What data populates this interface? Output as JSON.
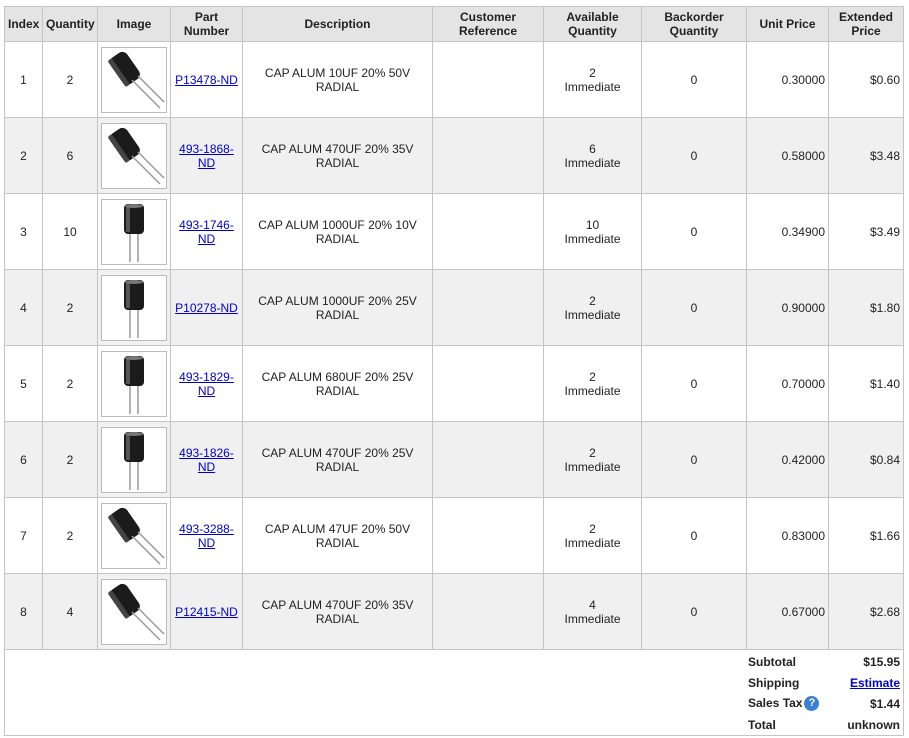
{
  "headers": {
    "index": "Index",
    "quantity": "Quantity",
    "image": "Image",
    "part_number_1": "Part",
    "part_number_2": "Number",
    "description": "Description",
    "customer_reference_1": "Customer",
    "customer_reference_2": "Reference",
    "available_1": "Available",
    "available_2": "Quantity",
    "backorder_1": "Backorder",
    "backorder_2": "Quantity",
    "unit_price": "Unit Price",
    "extended_1": "Extended",
    "extended_2": "Price"
  },
  "rows": [
    {
      "index": "1",
      "qty": "2",
      "pn1": "P13478-ND",
      "pn2": "",
      "desc1": "CAP ALUM 10UF 20% 50V",
      "desc2": "RADIAL",
      "avail_qty": "2",
      "avail_status": "Immediate",
      "backorder": "0",
      "unit": "0.30000",
      "ext": "$0.60",
      "thumb": "cap-bent"
    },
    {
      "index": "2",
      "qty": "6",
      "pn1": "493-1868-",
      "pn2": "ND",
      "desc1": "CAP ALUM 470UF 20% 35V",
      "desc2": "RADIAL",
      "avail_qty": "6",
      "avail_status": "Immediate",
      "backorder": "0",
      "unit": "0.58000",
      "ext": "$3.48",
      "thumb": "cap-bent"
    },
    {
      "index": "3",
      "qty": "10",
      "pn1": "493-1746-",
      "pn2": "ND",
      "desc1": "CAP ALUM 1000UF 20% 10V",
      "desc2": "RADIAL",
      "avail_qty": "10",
      "avail_status": "Immediate",
      "backorder": "0",
      "unit": "0.34900",
      "ext": "$3.49",
      "thumb": "cap-upright"
    },
    {
      "index": "4",
      "qty": "2",
      "pn1": "P10278-ND",
      "pn2": "",
      "desc1": "CAP ALUM 1000UF 20% 25V",
      "desc2": "RADIAL",
      "avail_qty": "2",
      "avail_status": "Immediate",
      "backorder": "0",
      "unit": "0.90000",
      "ext": "$1.80",
      "thumb": "cap-upright"
    },
    {
      "index": "5",
      "qty": "2",
      "pn1": "493-1829-",
      "pn2": "ND",
      "desc1": "CAP ALUM 680UF 20% 25V",
      "desc2": "RADIAL",
      "avail_qty": "2",
      "avail_status": "Immediate",
      "backorder": "0",
      "unit": "0.70000",
      "ext": "$1.40",
      "thumb": "cap-upright"
    },
    {
      "index": "6",
      "qty": "2",
      "pn1": "493-1826-",
      "pn2": "ND",
      "desc1": "CAP ALUM 470UF 20% 25V",
      "desc2": "RADIAL",
      "avail_qty": "2",
      "avail_status": "Immediate",
      "backorder": "0",
      "unit": "0.42000",
      "ext": "$0.84",
      "thumb": "cap-upright"
    },
    {
      "index": "7",
      "qty": "2",
      "pn1": "493-3288-",
      "pn2": "ND",
      "desc1": "CAP ALUM 47UF 20% 50V",
      "desc2": "RADIAL",
      "avail_qty": "2",
      "avail_status": "Immediate",
      "backorder": "0",
      "unit": "0.83000",
      "ext": "$1.66",
      "thumb": "cap-bent"
    },
    {
      "index": "8",
      "qty": "4",
      "pn1": "P12415-ND",
      "pn2": "",
      "desc1": "CAP ALUM 470UF 20% 35V",
      "desc2": "RADIAL",
      "avail_qty": "4",
      "avail_status": "Immediate",
      "backorder": "0",
      "unit": "0.67000",
      "ext": "$2.68",
      "thumb": "cap-bent"
    }
  ],
  "totals": {
    "subtotal_label": "Subtotal",
    "subtotal_value": "$15.95",
    "shipping_label": "Shipping",
    "shipping_value": "Estimate",
    "tax_label": "Sales Tax",
    "tax_help": "?",
    "tax_value": "$1.44",
    "total_label": "Total",
    "total_value": "unknown"
  },
  "colors": {
    "link": "#0000cc",
    "header_bg": "#e4e4e4",
    "row_alt_bg": "#f0f0f0",
    "help_icon": "#3b7fd0"
  }
}
